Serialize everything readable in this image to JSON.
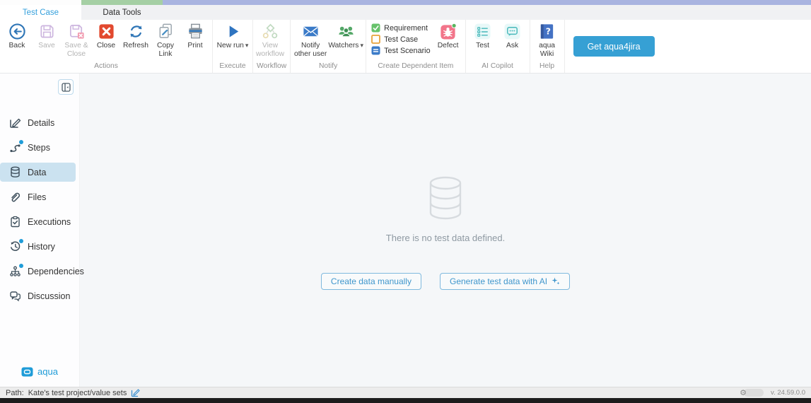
{
  "tabs": {
    "test_case": "Test Case",
    "data_tools": "Data Tools"
  },
  "ribbon": {
    "actions": {
      "label": "Actions",
      "back": "Back",
      "save": "Save",
      "save_close": "Save & Close",
      "close": "Close",
      "refresh": "Refresh",
      "copy_link": "Copy Link",
      "print": "Print"
    },
    "execute": {
      "label": "Execute",
      "new_run": "New run"
    },
    "workflow": {
      "label": "Workflow",
      "view_workflow": "View workflow"
    },
    "notify": {
      "label": "Notify",
      "notify_other_user": "Notify other user",
      "watchers": "Watchers"
    },
    "create_dependent": {
      "label": "Create Dependent Item",
      "requirement": "Requirement",
      "test_case": "Test Case",
      "test_scenario": "Test Scenario",
      "defect": "Defect"
    },
    "ai_copilot": {
      "label": "AI Copilot",
      "test": "Test",
      "ask": "Ask"
    },
    "help": {
      "label": "Help",
      "aqua_wiki": "aqua Wiki"
    },
    "get_aqua4jira": "Get aqua4jira"
  },
  "sidebar": {
    "items": [
      {
        "label": "Details",
        "icon": "edit-icon",
        "badge": false,
        "active": false
      },
      {
        "label": "Steps",
        "icon": "steps-icon",
        "badge": true,
        "active": false
      },
      {
        "label": "Data",
        "icon": "database-icon",
        "badge": false,
        "active": true
      },
      {
        "label": "Files",
        "icon": "paperclip-icon",
        "badge": false,
        "active": false
      },
      {
        "label": "Executions",
        "icon": "clipboard-icon",
        "badge": false,
        "active": false
      },
      {
        "label": "History",
        "icon": "history-icon",
        "badge": true,
        "active": false
      },
      {
        "label": "Dependencies",
        "icon": "tree-icon",
        "badge": true,
        "active": false
      },
      {
        "label": "Discussion",
        "icon": "chat-bubbles-icon",
        "badge": false,
        "active": false
      }
    ],
    "logo": "aqua"
  },
  "main": {
    "empty_message": "There is no test data defined.",
    "create_manually": "Create data manually",
    "generate_ai": "Generate test data with AI"
  },
  "statusbar": {
    "path_label": "Path:",
    "path_value": "Kate's test project/value sets",
    "version": "v. 24.59.0.0"
  },
  "colors": {
    "accent_blue": "#36a0d4",
    "active_tab_text": "#35a0dc",
    "titlebar_lavender": "#a9b4e0",
    "titlebar_green": "#a5cfa4",
    "close_red": "#e2492f",
    "ribbon_icon_blue": "#2e75b6",
    "watchers_green": "#54a868",
    "defect_pink": "#f2758a",
    "copilot_teal": "#46b8ba",
    "wiki_blue": "#4472c4",
    "selected_item_bg": "#cbe2f0",
    "badge_dot_blue": "#1f9cd8",
    "empty_text_gray": "#8e99a2"
  }
}
